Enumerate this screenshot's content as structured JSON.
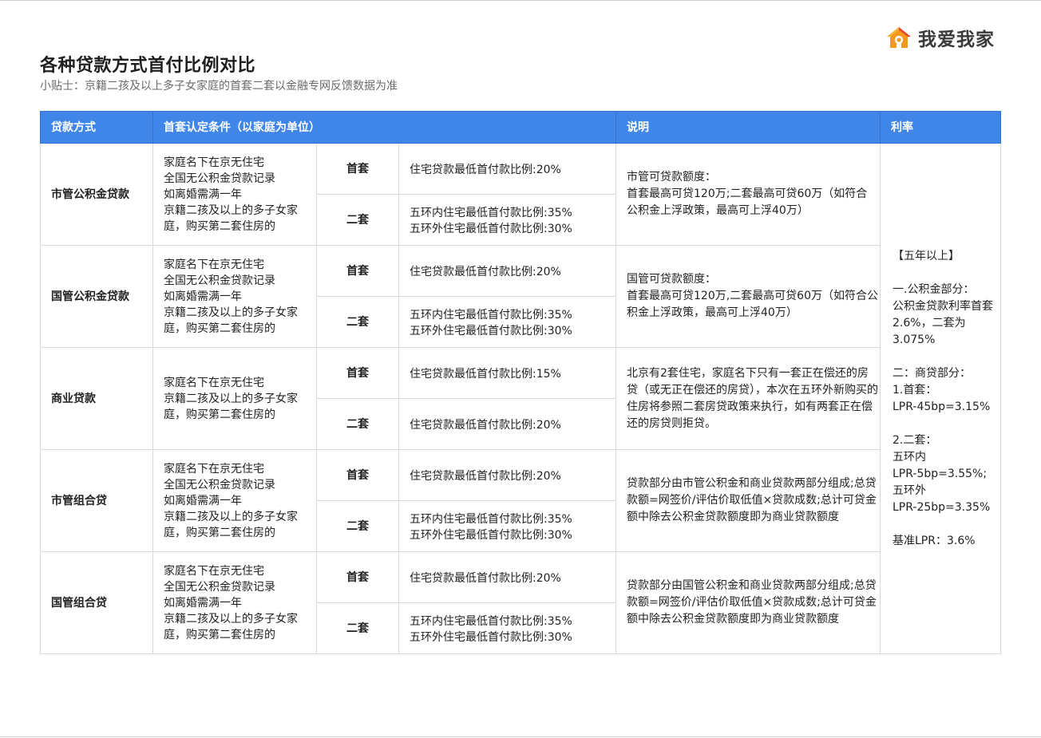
{
  "header": {
    "title": "各种贷款方式首付比例对比",
    "subtitle": "小贴士：京籍二孩及以上多子女家庭的首套二套以金融专网反馈数据为准"
  },
  "logo": {
    "text": "我爱我家",
    "icon": "house-logo-icon",
    "colors": {
      "orange": "#f39a1e",
      "red": "#e8452c"
    }
  },
  "table": {
    "header_color": "#3f86e8",
    "headers": {
      "method": "贷款方式",
      "condition": "首套认定条件（以家庭为单位）",
      "note": "说明",
      "rate": "利率"
    },
    "rate_text": "【五年以上】\n\n一.公积金部分：\n公积金贷款利率首套2.6%，二套为3.075%\n\n二：商贷部分：\n1.首套：\nLPR-45bp=3.15%\n\n2.二套：\n五环内\nLPR-5bp=3.55%;\n五环外\nLPR-25bp=3.35%\n\n基准LPR：3.6%",
    "groups": [
      {
        "name": "市管公积金贷款",
        "condition": "家庭名下在京无住宅\n全国无公积金贷款记录\n如离婚需满一年\n京籍二孩及以上的多子女家庭，购买第二套住房的",
        "first_label": "首套",
        "first_ratio": "住宅贷款最低首付款比例:20%",
        "second_label": "二套",
        "second_ratio": "五环内住宅最低首付款比例:35%\n五环外住宅最低首付款比例:30%",
        "note": "市管可贷款额度：\n首套最高可贷120万;二套最高可贷60万（如符合公积金上浮政策，最高可上浮40万）"
      },
      {
        "name": "国管公积金贷款",
        "condition": "家庭名下在京无住宅\n全国无公积金贷款记录\n如离婚需满一年\n京籍二孩及以上的多子女家庭，购买第二套住房的",
        "first_label": "首套",
        "first_ratio": "住宅贷款最低首付款比例:20%",
        "second_label": "二套",
        "second_ratio": "五环内住宅最低首付款比例:35%\n五环外住宅最低首付款比例:30%",
        "note": "国管可贷款额度：\n首套最高可贷120万,二套最高可贷60万（如符合公积金上浮政策，最高可上浮40万）"
      },
      {
        "name": "商业贷款",
        "condition": "家庭名下在京无住宅\n京籍二孩及以上的多子女家庭，购买第二套住房的",
        "first_label": "首套",
        "first_ratio": "住宅贷款最低首付款比例:15%",
        "second_label": "二套",
        "second_ratio": "住宅贷款最低首付款比例:20%",
        "note": "北京有2套住宅，家庭名下只有一套正在偿还的房贷（或无正在偿还的房贷），本次在五环外新购买的住房将参照二套房贷政策来执行，如有两套正在偿还的房贷则拒贷。"
      },
      {
        "name": "市管组合贷",
        "condition": "家庭名下在京无住宅\n全国无公积金贷款记录\n如离婚需满一年\n京籍二孩及以上的多子女家庭，购买第二套住房的",
        "first_label": "首套",
        "first_ratio": "住宅贷款最低首付款比例:20%",
        "second_label": "二套",
        "second_ratio": "五环内住宅最低首付款比例:35%\n五环外住宅最低首付款比例:30%",
        "note": "贷款部分由市管公积金和商业贷款两部分组成;总贷款额=网签价/评估价取低值×贷款成数;总计可贷金额中除去公积金贷款额度即为商业贷款额度"
      },
      {
        "name": "国管组合贷",
        "condition": "家庭名下在京无住宅\n全国无公积金贷款记录\n如离婚需满一年\n京籍二孩及以上的多子女家庭，购买第二套住房的",
        "first_label": "首套",
        "first_ratio": "住宅贷款最低首付款比例:20%",
        "second_label": "二套",
        "second_ratio": "五环内住宅最低首付款比例:35%\n五环外住宅最低首付款比例:30%",
        "note": "贷款部分由国管公积金和商业贷款两部分组成;总贷款额=网签价/评估价取低值×贷款成数;总计可贷金额中除去公积金贷款额度即为商业贷款额度"
      }
    ]
  }
}
